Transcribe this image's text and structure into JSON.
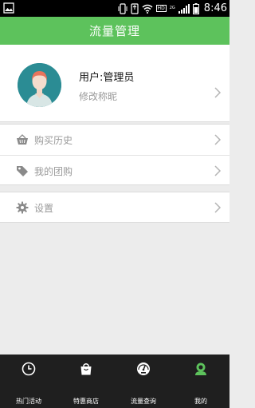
{
  "status_bar": {
    "time": "8:46",
    "carrier_badge": "HD",
    "network_text": "2G"
  },
  "header": {
    "title": "流量管理"
  },
  "profile": {
    "username": "用户:管理员",
    "edit_nickname": "修改称昵"
  },
  "menu": {
    "purchase_history": "购买历史",
    "my_group_buy": "我的团购",
    "settings": "设置"
  },
  "bottom_nav": {
    "tabs": [
      {
        "label": "热门活动",
        "icon": "clock-icon"
      },
      {
        "label": "特惠商店",
        "icon": "bag-icon"
      },
      {
        "label": "流量查询",
        "icon": "gauge-icon"
      },
      {
        "label": "我的",
        "icon": "user-icon"
      }
    ],
    "active_index": 3
  },
  "colors": {
    "header_green": "#5dc25c",
    "active_tab": "#5dc25c",
    "avatar_bg": "#2b8c94"
  }
}
